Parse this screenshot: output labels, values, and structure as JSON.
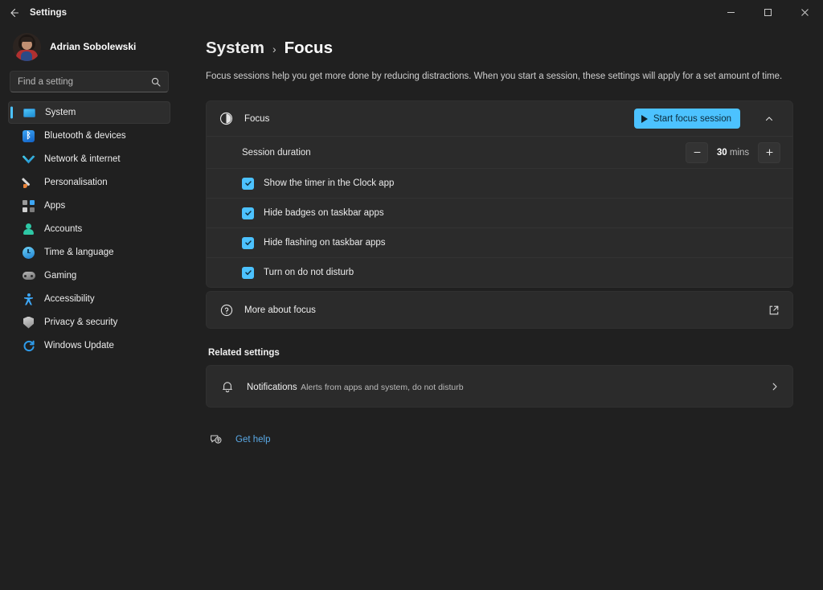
{
  "titlebar": {
    "back_label": "back-arrow",
    "title": "Settings",
    "minimize": "minimize",
    "maximize": "maximize",
    "close": "close"
  },
  "sidebar": {
    "profile": {
      "name": "Adrian Sobolewski",
      "subtitle": ""
    },
    "search": {
      "placeholder": "Find a setting",
      "value": ""
    },
    "items": [
      {
        "label": "System",
        "icon": "monitor-icon",
        "selected": true
      },
      {
        "label": "Bluetooth & devices",
        "icon": "bluetooth-icon",
        "selected": false
      },
      {
        "label": "Network & internet",
        "icon": "wifi-icon",
        "selected": false
      },
      {
        "label": "Personalisation",
        "icon": "paintbrush-icon",
        "selected": false
      },
      {
        "label": "Apps",
        "icon": "apps-grid-icon",
        "selected": false
      },
      {
        "label": "Accounts",
        "icon": "person-icon",
        "selected": false
      },
      {
        "label": "Time & language",
        "icon": "clock-icon",
        "selected": false
      },
      {
        "label": "Gaming",
        "icon": "gamepad-icon",
        "selected": false
      },
      {
        "label": "Accessibility",
        "icon": "accessibility-icon",
        "selected": false
      },
      {
        "label": "Privacy & security",
        "icon": "shield-icon",
        "selected": false
      },
      {
        "label": "Windows Update",
        "icon": "refresh-icon",
        "selected": false
      }
    ]
  },
  "main": {
    "breadcrumb": {
      "parent": "System",
      "separator": "›",
      "current": "Focus"
    },
    "description": "Focus sessions help you get more done by reducing distractions. When you start a session, these settings will apply for a set amount of time.",
    "focus_card": {
      "icon": "focus-moon-icon",
      "title": "Focus",
      "start_button": {
        "label": "Start focus session",
        "icon": "play-icon"
      },
      "expand_icon": "chevron-up-icon",
      "duration": {
        "label": "Session duration",
        "decrease_icon": "minus-icon",
        "increase_icon": "plus-icon",
        "value": "30",
        "unit": "mins"
      },
      "checkboxes": [
        {
          "label": "Show the timer in the Clock app",
          "checked": true
        },
        {
          "label": "Hide badges on taskbar apps",
          "checked": true
        },
        {
          "label": "Hide flashing on taskbar apps",
          "checked": true
        },
        {
          "label": "Turn on do not disturb",
          "checked": true
        }
      ]
    },
    "more_about": {
      "icon": "help-circle-icon",
      "label": "More about focus",
      "external_icon": "external-link-icon"
    },
    "related_settings": {
      "section_label": "Related settings",
      "items": [
        {
          "icon": "bell-icon",
          "title": "Notifications",
          "subtitle": "Alerts from apps and system, do not disturb",
          "chevron": "chevron-right-icon"
        }
      ]
    },
    "get_help": {
      "icon": "question-bubble-icon",
      "label": "Get help"
    }
  },
  "colors": {
    "accent": "#4cc2ff",
    "page_bg": "#202020",
    "card_bg": "#2b2b2b",
    "link": "#5aa9e6"
  }
}
